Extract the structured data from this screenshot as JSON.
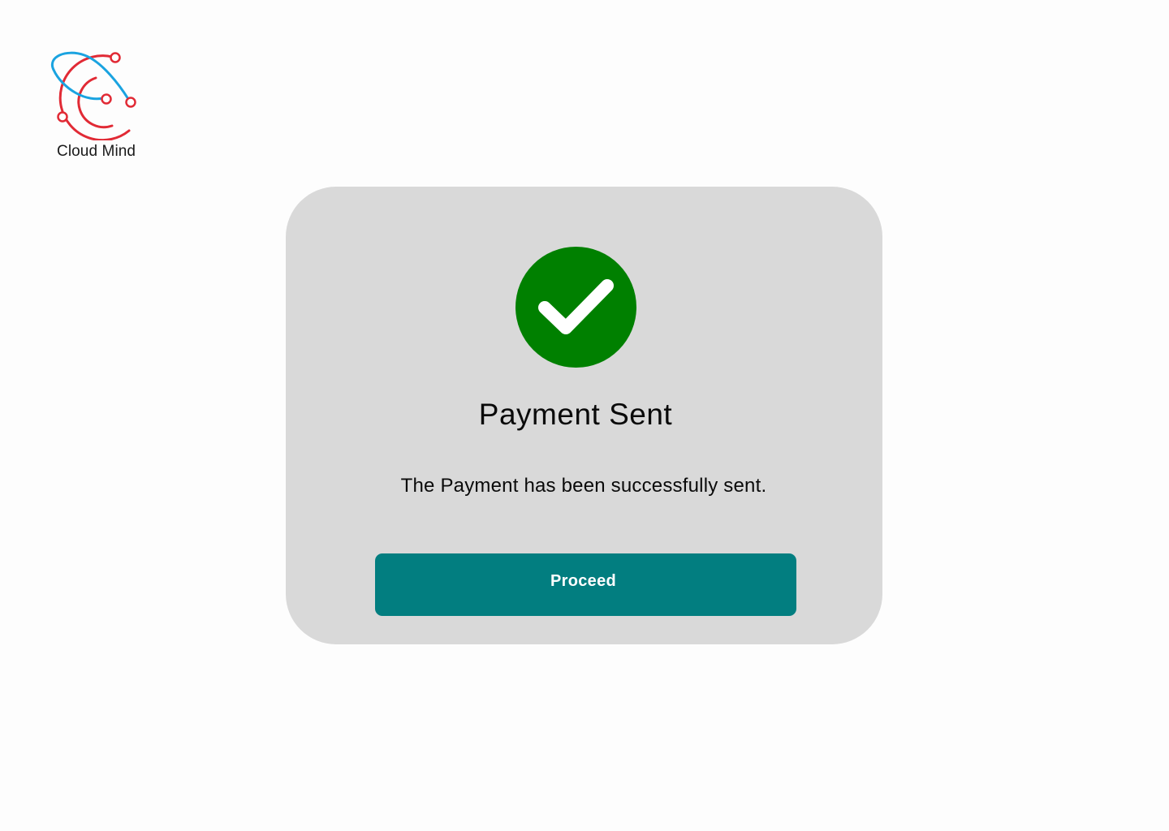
{
  "brand": {
    "name": "Cloud Mind",
    "logo_icon": "orbit-logo-icon",
    "colors": {
      "red": "#e12a35",
      "blue": "#1aa3e0"
    }
  },
  "dialog": {
    "icon": "checkmark-icon",
    "icon_color": "#008000",
    "title": "Payment Sent",
    "message": "The Payment has been successfully sent.",
    "button_label": "Proceed",
    "button_color": "#027e80",
    "card_color": "#d9d9d9"
  }
}
